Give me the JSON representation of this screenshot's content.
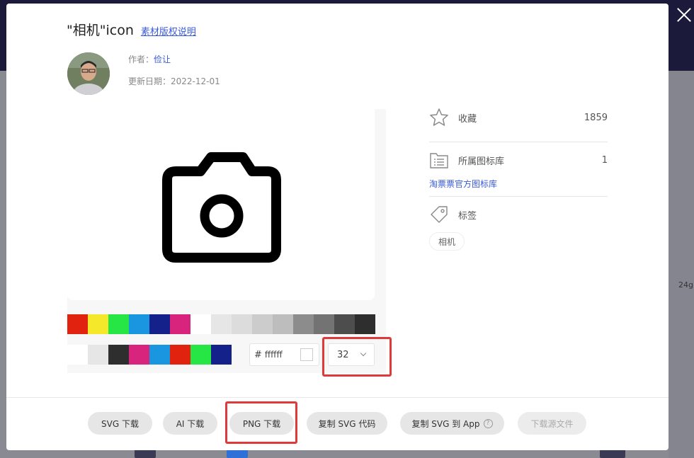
{
  "window": {
    "title_text": "\"相机\"icon",
    "copyright_link": "素材版权说明"
  },
  "author": {
    "label": "作者：",
    "name": "俭让",
    "updated_label": "更新日期：",
    "updated_date": "2022-12-01"
  },
  "colors": {
    "row1": [
      "#e0220f",
      "#f5e82b",
      "#26e645",
      "#1a96e0",
      "#14218a",
      "#d9247e",
      "#ffffff",
      "#e6e6e6",
      "#dcdcdc",
      "#cccccc",
      "#bdbdbd",
      "#8c8c8c",
      "#737373",
      "#4d4d4d",
      "#2e2e2e"
    ],
    "row2": [
      "#ffffff",
      "#e6e6e6",
      "#2e2e2e",
      "#d9247e",
      "#1a96e0",
      "#e0220f",
      "#26e645",
      "#14218a"
    ],
    "accent": "#3a5bd9",
    "highlight": "#e0393b"
  },
  "color_input": {
    "hash": "#",
    "value": "ffffff"
  },
  "size_select": {
    "value": "32"
  },
  "info": {
    "favorites_label": "收藏",
    "favorites_count": "1859",
    "library_label": "所属图标库",
    "library_count": "1",
    "library_link": "淘票票官方图标库",
    "tags_label": "标签",
    "tag": "相机"
  },
  "buttons": {
    "svg_download": "SVG 下载",
    "ai_download": "AI 下载",
    "png_download": "PNG 下载",
    "copy_svg_code": "复制 SVG 代码",
    "copy_svg_app": "复制 SVG 到 App",
    "download_source": "下载源文件"
  },
  "background": {
    "side_text": "24g"
  }
}
